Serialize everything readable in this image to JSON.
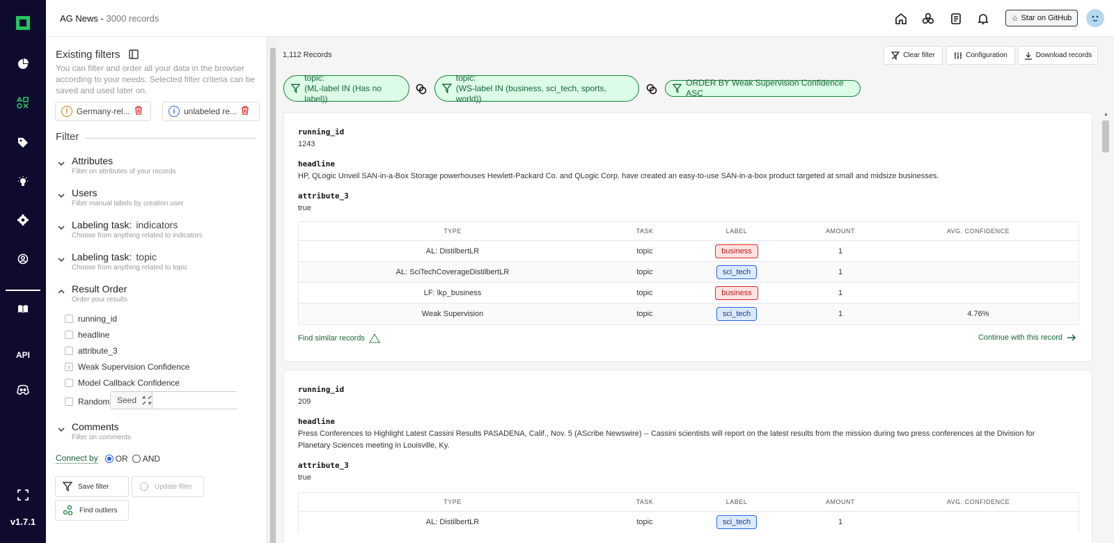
{
  "app": {
    "dataset": "AG News",
    "record_count": "3000 records",
    "version": "v1.7.1",
    "api_label": "API"
  },
  "topbar": {
    "github": "Star on GitHub"
  },
  "filters": {
    "heading": "Existing filters",
    "description": "You can filter and order all your data in the browser according to your needs. Selected filter criteria can be saved and used later on.",
    "saved": [
      {
        "name": "Germany-rel...",
        "color": "#d97706"
      },
      {
        "name": "unlabeled re...",
        "color": "#2563eb"
      }
    ],
    "filter_heading": "Filter",
    "sections": [
      {
        "title": "Attributes",
        "task": "",
        "subtitle": "Filter on attributes of your records"
      },
      {
        "title": "Users",
        "task": "",
        "subtitle": "Filter manual labels by creation user"
      },
      {
        "title": "Labeling task:",
        "task": "indicators",
        "subtitle": "Choose from anything related to indicators"
      },
      {
        "title": "Labeling task:",
        "task": "topic",
        "subtitle": "Choose from anything related to topic"
      },
      {
        "title": "Result Order",
        "task": "",
        "subtitle": "Order your results"
      },
      {
        "title": "Comments",
        "task": "",
        "subtitle": "Filter on comments"
      }
    ],
    "order_options": [
      "running_id",
      "headline",
      "attribute_3",
      "Weak Supervision Confidence",
      "Model Callback Confidence",
      "Random"
    ],
    "seed_label": "Seed",
    "seed_value": "",
    "connect_label": "Connect by",
    "connect_or": "OR",
    "connect_and": "AND",
    "save_filter": "Save filter",
    "update_filter": "Update filter",
    "find_outliers": "Find outliers"
  },
  "main": {
    "records_found": "1,112 Records",
    "clear_filter": "Clear filter",
    "configuration": "Configuration",
    "download": "Download records",
    "pills": [
      {
        "line1": "topic:",
        "line2": "(ML-label IN (Has no label))"
      },
      {
        "line1": "topic:",
        "line2": "(WS-label IN (business, sci_tech, sports, world))"
      },
      {
        "line1": "ORDER BY Weak Supervision Confidence ASC",
        "line2": ""
      }
    ],
    "table_headers": [
      "TYPE",
      "TASK",
      "LABEL",
      "AMOUNT",
      "AVG. CONFIDENCE"
    ],
    "find_similar": "Find similar records",
    "continue": "Continue with this record",
    "records": [
      {
        "running_id": "1243",
        "headline": "HP, QLogic Unveil SAN-in-a-Box Storage powerhouses Hewlett-Packard Co. and QLogic Corp. have created an easy-to-use SAN-in-a-box product targeted at small and midsize businesses.",
        "attribute_3": "true",
        "rows": [
          {
            "type": "AL: DistilbertLR",
            "task": "topic",
            "label": "business",
            "amount": "1",
            "conf": ""
          },
          {
            "type": "AL: SciTechCoverageDistilbertLR",
            "task": "topic",
            "label": "sci_tech",
            "amount": "1",
            "conf": ""
          },
          {
            "type": "LF: lkp_business",
            "task": "topic",
            "label": "business",
            "amount": "1",
            "conf": ""
          },
          {
            "type": "Weak Supervision",
            "task": "topic",
            "label": "sci_tech",
            "amount": "1",
            "conf": "4.76%"
          }
        ]
      },
      {
        "running_id": "209",
        "headline": "Press Conferences to Highlight Latest Cassini Results PASADENA, Calif., Nov. 5 (AScribe Newswire) -- Cassini scientists will report on the latest results from the mission during two press conferences at the Division for Planetary Sciences meeting in Louisville, Ky.",
        "attribute_3": "true",
        "rows": [
          {
            "type": "AL: DistilbertLR",
            "task": "topic",
            "label": "sci_tech",
            "amount": "1",
            "conf": ""
          }
        ]
      }
    ],
    "field_names": [
      "running_id",
      "headline",
      "attribute_3"
    ]
  }
}
